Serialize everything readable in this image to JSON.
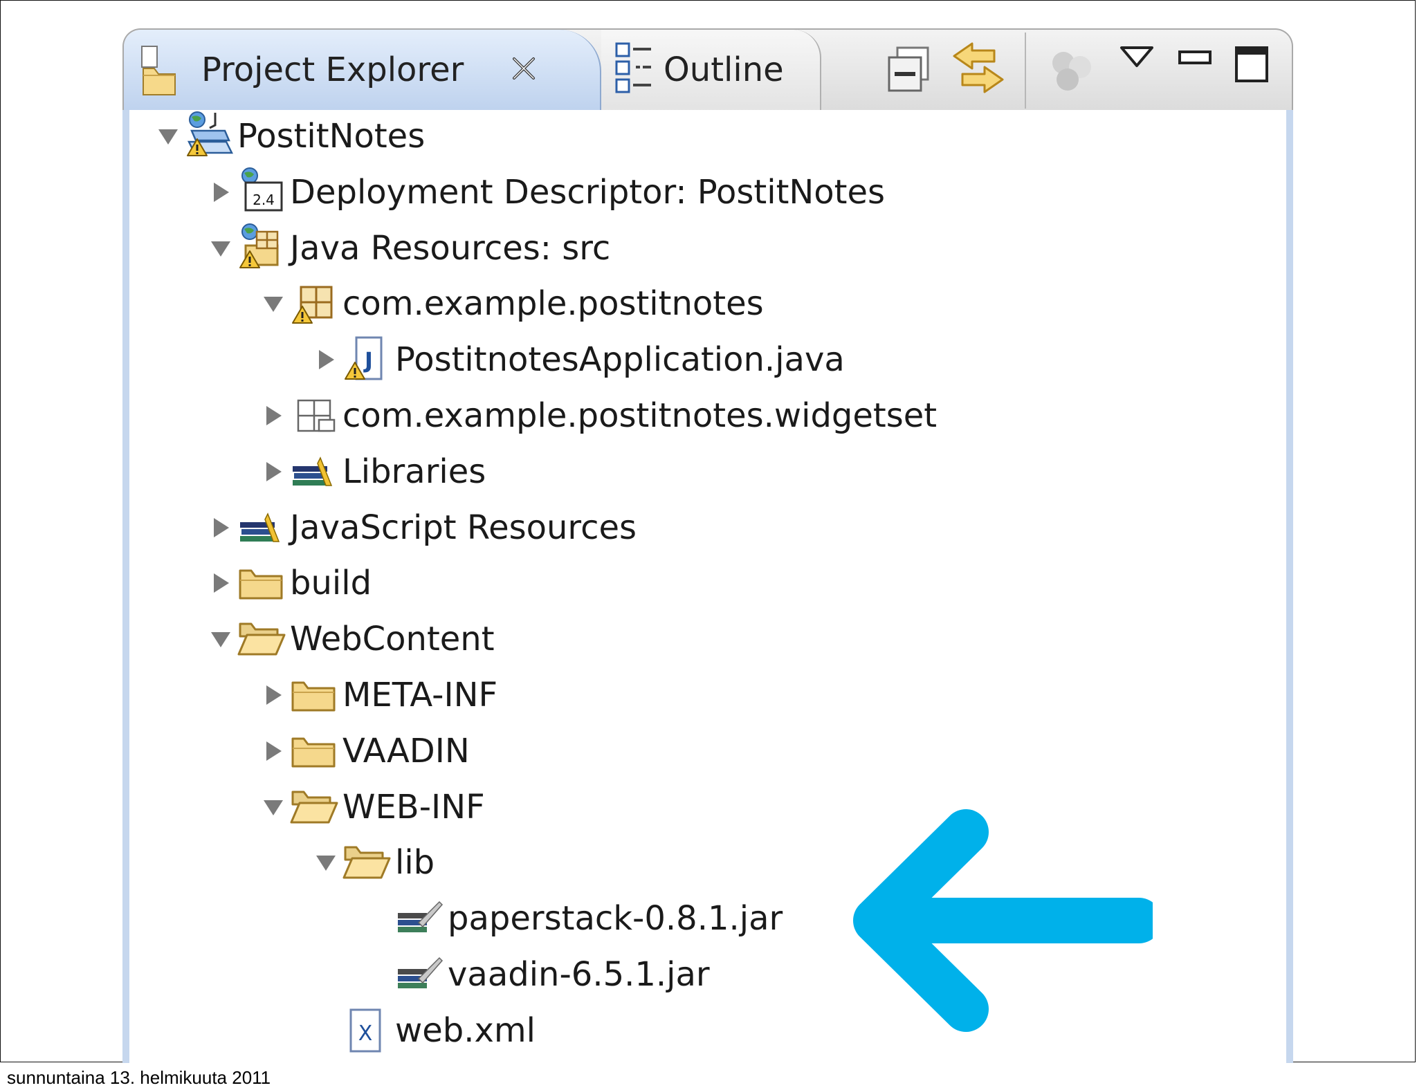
{
  "tabs": [
    {
      "label": "Project Explorer",
      "active": true
    },
    {
      "label": "Outline",
      "active": false
    }
  ],
  "toolbar": {
    "icons": [
      "collapse-all-icon",
      "link-with-editor-icon",
      "filters-icon",
      "view-menu-icon",
      "minimize-icon",
      "maximize-icon"
    ]
  },
  "tree": [
    {
      "label": "PostitNotes",
      "depth": 0,
      "twisty": "expanded",
      "icon": "web-project-warning-icon"
    },
    {
      "label": "Deployment Descriptor: PostitNotes",
      "depth": 1,
      "twisty": "collapsed",
      "icon": "deployment-descriptor-icon"
    },
    {
      "label": "Java Resources: src",
      "depth": 1,
      "twisty": "expanded",
      "icon": "java-resources-warning-icon"
    },
    {
      "label": "com.example.postitnotes",
      "depth": 2,
      "twisty": "expanded",
      "icon": "package-warning-icon"
    },
    {
      "label": "PostitnotesApplication.java",
      "depth": 3,
      "twisty": "collapsed",
      "icon": "java-file-warning-icon"
    },
    {
      "label": "com.example.postitnotes.widgetset",
      "depth": 2,
      "twisty": "collapsed",
      "icon": "empty-package-icon"
    },
    {
      "label": "Libraries",
      "depth": 2,
      "twisty": "collapsed",
      "icon": "libraries-icon"
    },
    {
      "label": "JavaScript Resources",
      "depth": 1,
      "twisty": "collapsed",
      "icon": "libraries-icon"
    },
    {
      "label": "build",
      "depth": 1,
      "twisty": "collapsed",
      "icon": "folder-icon"
    },
    {
      "label": "WebContent",
      "depth": 1,
      "twisty": "expanded",
      "icon": "folder-open-icon"
    },
    {
      "label": "META-INF",
      "depth": 2,
      "twisty": "collapsed",
      "icon": "folder-icon"
    },
    {
      "label": "VAADIN",
      "depth": 2,
      "twisty": "collapsed",
      "icon": "folder-icon"
    },
    {
      "label": "WEB-INF",
      "depth": 2,
      "twisty": "expanded",
      "icon": "folder-open-icon"
    },
    {
      "label": "lib",
      "depth": 3,
      "twisty": "expanded",
      "icon": "folder-open-icon"
    },
    {
      "label": "paperstack-0.8.1.jar",
      "depth": 4,
      "twisty": "none",
      "icon": "jar-icon"
    },
    {
      "label": "vaadin-6.5.1.jar",
      "depth": 4,
      "twisty": "none",
      "icon": "jar-icon"
    },
    {
      "label": "web.xml",
      "depth": 3,
      "twisty": "none",
      "icon": "xml-file-icon"
    }
  ],
  "colors": {
    "arrow": "#00B1EA",
    "active_tab": "#C9DBF2",
    "frame": "#C6D7EE"
  },
  "footer": {
    "text": "sunnuntaina 13. helmikuuta 2011"
  }
}
